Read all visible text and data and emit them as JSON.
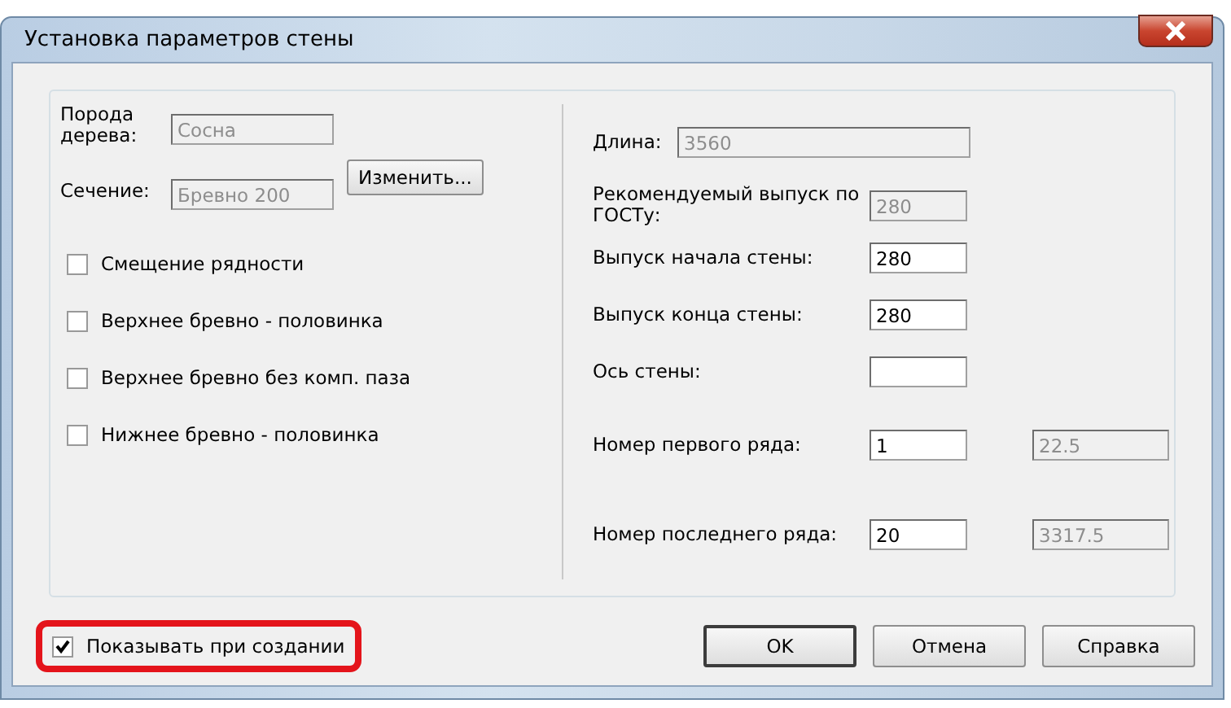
{
  "window": {
    "title": "Установка параметров стены"
  },
  "left_fields": [
    {
      "label": "Порода дерева:",
      "value": "Сосна",
      "disabled": true
    },
    {
      "label": "Сечение:",
      "value": "Бревно 200",
      "disabled": true
    }
  ],
  "change_button": "Изменить...",
  "options": [
    {
      "label": "Смещение рядности",
      "checked": false
    },
    {
      "label": "Верхнее бревно - половинка",
      "checked": false
    },
    {
      "label": "Верхнее бревно без комп. паза",
      "checked": false
    },
    {
      "label": "Нижнее бревно - половинка",
      "checked": false
    }
  ],
  "right_fields": [
    {
      "label": "Длина:",
      "value": "3560",
      "disabled": true
    },
    {
      "label": "Рекомендуемый выпуск по ГОСТу:",
      "value": "280",
      "disabled": true
    },
    {
      "label": "Выпуск начала стены:",
      "value": "280",
      "disabled": false
    },
    {
      "label": "Выпуск конца стены:",
      "value": "280",
      "disabled": false
    },
    {
      "label": "Ось стены:",
      "disabled": false
    },
    {
      "label": "Номер первого ряда:",
      "value": "1",
      "disabled": false,
      "extra": {
        "value": "22.5",
        "disabled": true
      }
    },
    {
      "label": "Номер последнего ряда:",
      "value": "20",
      "disabled": false,
      "extra": {
        "value": "3317.5",
        "disabled": true
      }
    }
  ],
  "show_on_create": {
    "label": "Показывать при создании",
    "checked": true,
    "highlighted": true
  },
  "buttons": [
    {
      "label": "OK",
      "default": true
    },
    {
      "label": "Отмена",
      "default": false
    },
    {
      "label": "Справка",
      "default": false
    }
  ]
}
